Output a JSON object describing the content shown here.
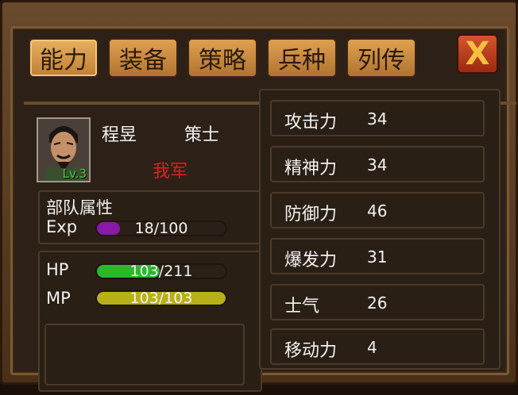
{
  "tabs": [
    "能力",
    "装备",
    "策略",
    "兵种",
    "列传"
  ],
  "close_label": "X",
  "character": {
    "name": "程昱",
    "class": "策士",
    "level": "Lv.3",
    "army": "我军"
  },
  "troop": {
    "title": "部队属性",
    "exp_label": "Exp",
    "exp_text": "18/100",
    "exp_value": 18,
    "exp_max": 100
  },
  "hp": {
    "label": "HP",
    "text": "103/211",
    "value": 103,
    "max": 211
  },
  "mp": {
    "label": "MP",
    "text": "103/103",
    "value": 103,
    "max": 103
  },
  "stats": [
    {
      "name": "攻击力",
      "value": "34"
    },
    {
      "name": "精神力",
      "value": "34"
    },
    {
      "name": "防御力",
      "value": "46"
    },
    {
      "name": "爆发力",
      "value": "31"
    },
    {
      "name": "士气",
      "value": "26"
    },
    {
      "name": "移动力",
      "value": "4"
    }
  ],
  "colors": {
    "exp": "#8a18a8",
    "hp": "#2ab82a",
    "mp": "#b8b018",
    "army": "#e02020",
    "tab": "#c07e34"
  }
}
